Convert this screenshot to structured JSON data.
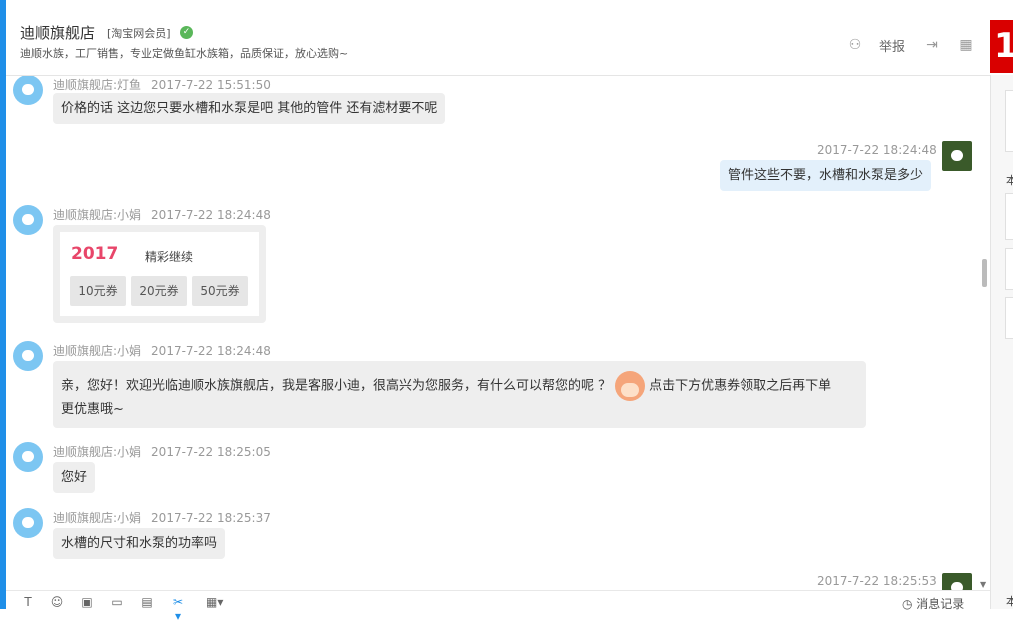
{
  "header": {
    "shop_name": "迪顺旗舰店",
    "member_tag": "[淘宝网会员]",
    "verified_icon": "check-circle-icon",
    "description": "迪顺水族，工厂销售，专业定做鱼缸水族箱，品质保证，放心选购~",
    "report_label": "举报",
    "brand_mark": "1"
  },
  "right_panel": {
    "text1": "本",
    "text2": "本"
  },
  "messages": [
    {
      "sender": "迪顺旗舰店:灯鱼",
      "time": "2017-7-22 15:51:50",
      "text": "价格的话  这边您只要水槽和水泵是吧    其他的管件   还有滤材要不呢"
    },
    {
      "sender": "",
      "time": "2017-7-22 18:24:48",
      "text": "管件这些不要，水槽和水泵是多少"
    },
    {
      "sender": "迪顺旗舰店:小娟",
      "time": "2017-7-22 18:24:48",
      "coupon": {
        "year": "2017",
        "subtitle": "精彩继续",
        "buttons": [
          "10元券",
          "20元券",
          "50元券"
        ]
      }
    },
    {
      "sender": "迪顺旗舰店:小娟",
      "time": "2017-7-22 18:24:48",
      "text_part1": "亲，您好！欢迎光临迪顺水族旗舰店，我是客服小迪，很高兴为您服务，有什么可以帮您的呢 ？",
      "text_part2": "点击下方优惠券领取之后再下单",
      "text_part3": "更优惠哦~"
    },
    {
      "sender": "迪顺旗舰店:小娟",
      "time": "2017-7-22 18:25:05",
      "text": "您好"
    },
    {
      "sender": "迪顺旗舰店:小娟",
      "time": "2017-7-22 18:25:37",
      "text": "水槽的尺寸和水泵的功率吗"
    },
    {
      "sender": "",
      "time": "2017-7-22 18:25:53"
    }
  ],
  "toolbar": {
    "icons": [
      "font-icon",
      "emoji-icon",
      "image-icon",
      "screenshot-icon",
      "file-icon",
      "scissors-icon",
      "table-icon"
    ],
    "history_label": "消息记录"
  },
  "colors": {
    "accent_blue": "#1f8fe8",
    "brand_red": "#d90000",
    "bubble_gray": "#eeeeee",
    "bubble_blue": "#e3f0fb",
    "verified_green": "#5ab75a"
  }
}
